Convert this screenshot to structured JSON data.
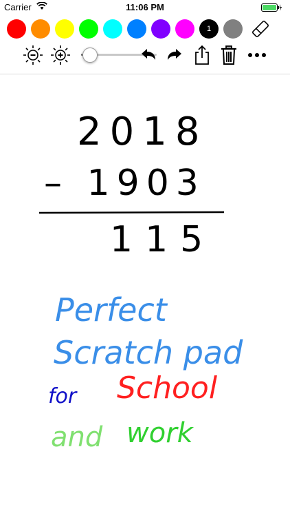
{
  "status_bar": {
    "carrier": "Carrier",
    "time": "11:06 PM"
  },
  "palette": {
    "colors": [
      {
        "name": "red",
        "hex": "#ff0000"
      },
      {
        "name": "orange",
        "hex": "#ff8c00"
      },
      {
        "name": "yellow",
        "hex": "#ffff00"
      },
      {
        "name": "green",
        "hex": "#00ff00"
      },
      {
        "name": "cyan",
        "hex": "#00ffff"
      },
      {
        "name": "blue",
        "hex": "#0080ff"
      },
      {
        "name": "purple",
        "hex": "#8000ff"
      },
      {
        "name": "magenta",
        "hex": "#ff00ff"
      },
      {
        "name": "black",
        "hex": "#000000",
        "label": "1",
        "selected": true
      },
      {
        "name": "gray",
        "hex": "#808080"
      }
    ],
    "eraser_icon": "eraser-icon"
  },
  "toolbar": {
    "icons": [
      "brightness-decrease-icon",
      "brightness-increase-icon",
      "undo-icon",
      "redo-icon",
      "share-icon",
      "trash-icon",
      "more-icon"
    ],
    "brush_size_fraction": 0.05
  },
  "drawing": {
    "math_top": "2018",
    "math_minus": "– 1903",
    "math_result": "115",
    "line1": "Perfect",
    "line2": "Scratch pad",
    "line3_a": "for",
    "line3_b": "School",
    "line4_a": "and",
    "line4_b": "work",
    "colors": {
      "black": "#000000",
      "blue": "#3a8ee8",
      "dark_blue": "#1010c8",
      "red": "#ff2020",
      "light_green": "#80e070",
      "green": "#30d030"
    }
  }
}
